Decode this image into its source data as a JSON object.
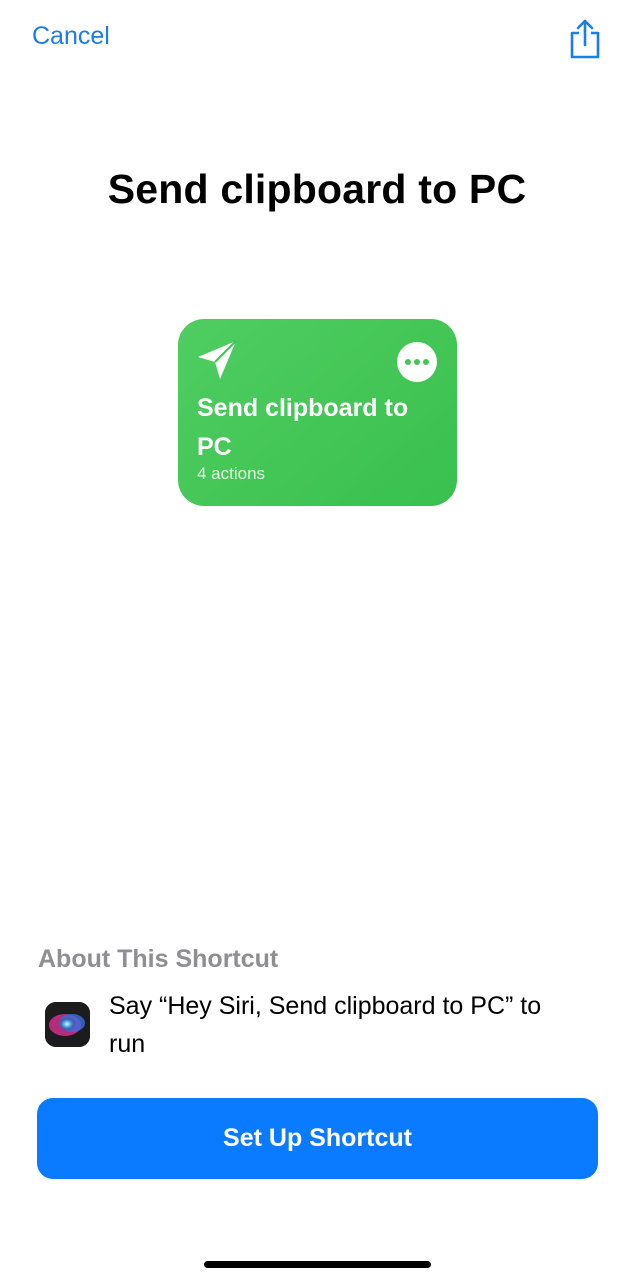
{
  "nav": {
    "cancel_label": "Cancel",
    "share_icon": "share-icon"
  },
  "shortcut": {
    "title": "Send clipboard to PC",
    "card": {
      "name": "Send clipboard to PC",
      "actions_count": "4 actions",
      "icon": "paper-plane-icon",
      "more_icon": "more-icon",
      "color": "#44c656"
    }
  },
  "about": {
    "heading": "About This Shortcut",
    "siri_text": "Say “Hey Siri, Send clipboard to PC” to run",
    "siri_icon": "siri-icon"
  },
  "setup_button_label": "Set Up Shortcut",
  "colors": {
    "accent": "#0a7bff",
    "link": "#1a7ee6",
    "secondary_text": "#8e8e93"
  }
}
